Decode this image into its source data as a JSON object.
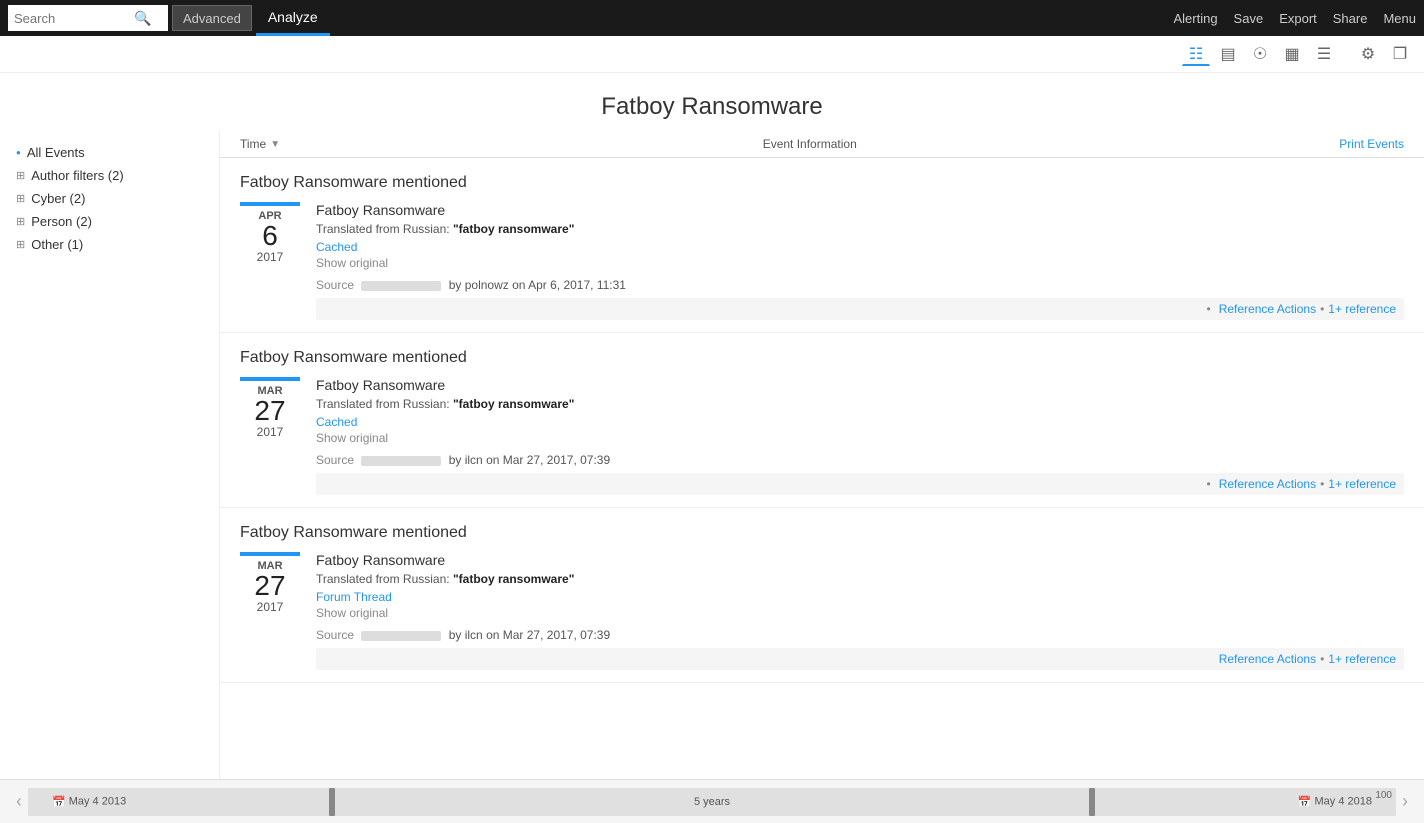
{
  "nav": {
    "search_placeholder": "Search",
    "advanced_label": "Advanced",
    "analyze_label": "Analyze",
    "alerting_label": "Alerting",
    "save_label": "Save",
    "export_label": "Export",
    "share_label": "Share",
    "menu_label": "Menu"
  },
  "toolbar": {
    "icons": [
      "table-icon",
      "chart-icon",
      "map-icon",
      "grid-icon",
      "list-icon",
      "settings-icon",
      "expand-icon"
    ]
  },
  "page": {
    "title": "Fatboy Ransomware"
  },
  "col_headers": {
    "time": "Time",
    "event_info": "Event Information",
    "print_events": "Print Events"
  },
  "sidebar": {
    "items": [
      {
        "label": "All Events",
        "type": "bullet"
      },
      {
        "label": "Author filters (2)",
        "type": "plus"
      },
      {
        "label": "Cyber (2)",
        "type": "plus"
      },
      {
        "label": "Person (2)",
        "type": "plus"
      },
      {
        "label": "Other (1)",
        "type": "plus"
      }
    ]
  },
  "events": [
    {
      "title": "Fatboy Ransomware mentioned",
      "source_name": "Fatboy Ransomware",
      "translated_prefix": "Translated from Russian: ",
      "translated_term": "fatboy ransomware",
      "link_label": "Cached",
      "link_type": "cached",
      "show_original": "Show original",
      "source_label": "Source",
      "by_text": "by polnowz on Apr 6, 2017, 11:31",
      "date_month": "APR",
      "date_day": "6",
      "date_year": "2017",
      "ref_actions": "Reference Actions",
      "ref_count": "1+ reference"
    },
    {
      "title": "Fatboy Ransomware mentioned",
      "source_name": "Fatboy Ransomware",
      "translated_prefix": "Translated from Russian: ",
      "translated_term": "fatboy ransomware",
      "link_label": "Cached",
      "link_type": "cached",
      "show_original": "Show original",
      "source_label": "Source",
      "by_text": "by ilcn on Mar 27, 2017, 07:39",
      "date_month": "MAR",
      "date_day": "27",
      "date_year": "2017",
      "ref_actions": "Reference Actions",
      "ref_count": "1+ reference"
    },
    {
      "title": "Fatboy Ransomware mentioned",
      "source_name": "Fatboy Ransomware",
      "translated_prefix": "Translated from Russian: ",
      "translated_term": "fatboy ransomware",
      "link_label": "Forum Thread",
      "link_type": "forum",
      "show_original": "Show original",
      "source_label": "Source",
      "by_text": "by ilcn on Mar 27, 2017, 07:39",
      "date_month": "MAR",
      "date_day": "27",
      "date_year": "2017",
      "ref_actions": "Reference Actions",
      "ref_count": "1+ reference"
    }
  ],
  "timeline": {
    "left_date": "May 4 2013",
    "center_label": "5 years",
    "right_date": "May 4 2018",
    "count": "100"
  }
}
